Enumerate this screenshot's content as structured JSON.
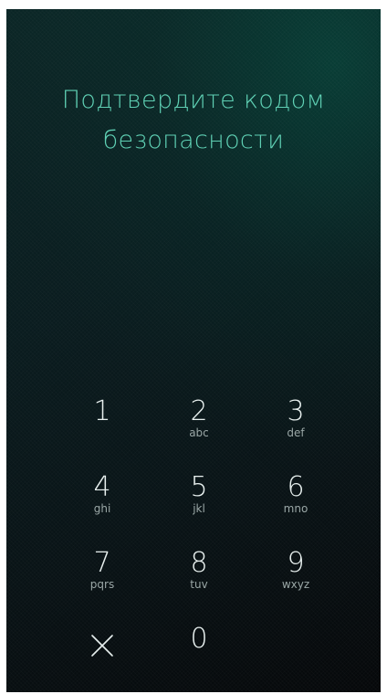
{
  "prompt": {
    "line1": "Подтвердите кодом",
    "line2": "безопасности"
  },
  "keypad": {
    "keys": [
      {
        "digit": "1",
        "letters": ""
      },
      {
        "digit": "2",
        "letters": "abc"
      },
      {
        "digit": "3",
        "letters": "def"
      },
      {
        "digit": "4",
        "letters": "ghi"
      },
      {
        "digit": "5",
        "letters": "jkl"
      },
      {
        "digit": "6",
        "letters": "mno"
      },
      {
        "digit": "7",
        "letters": "pqrs"
      },
      {
        "digit": "8",
        "letters": "tuv"
      },
      {
        "digit": "9",
        "letters": "wxyz"
      },
      {
        "digit": "0",
        "letters": ""
      }
    ],
    "cancel_icon": "close-icon"
  },
  "colors": {
    "accent": "#5fd0b4",
    "key_text": "#e8f0ef",
    "sub_text": "#9aa7a6",
    "background": "#0a1c1f"
  }
}
